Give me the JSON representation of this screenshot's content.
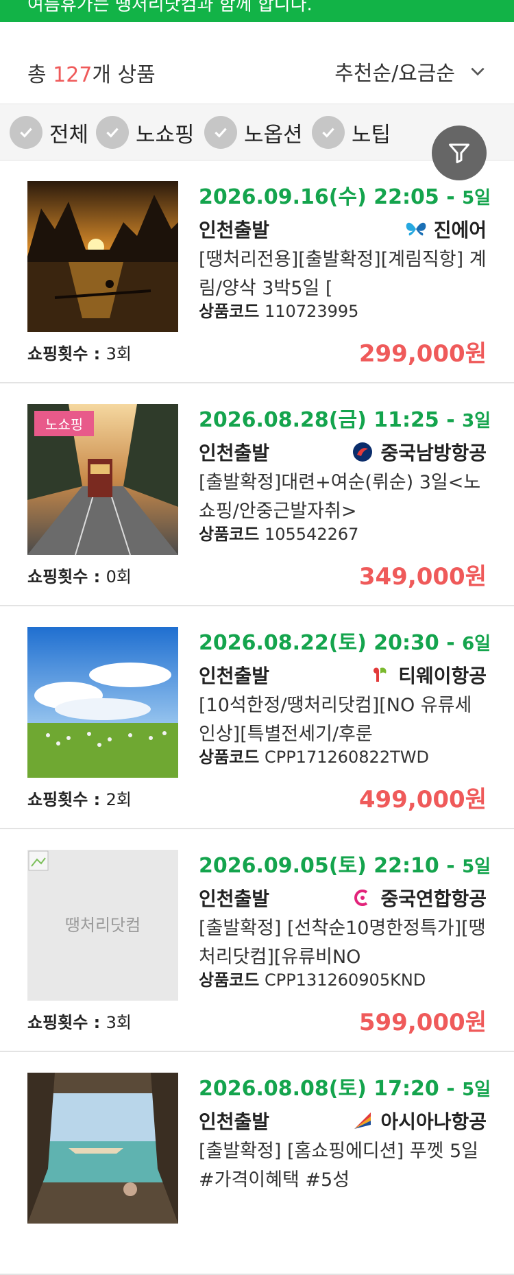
{
  "top_banner": {
    "text": "여름휴가는 땡처리닷컴과 함께 합니다."
  },
  "summary": {
    "prefix": "총 ",
    "count": "127",
    "suffix": "개 상품",
    "sort_label": "추천순/요금순"
  },
  "filters": [
    {
      "label": "전체"
    },
    {
      "label": "노쇼핑"
    },
    {
      "label": "노옵션"
    },
    {
      "label": "노팁"
    }
  ],
  "colors": {
    "accent_green": "#12b347",
    "date_green": "#14a44d",
    "price_red": "#ef5a5a",
    "badge_pink": "#e85a8a",
    "fab_gray": "#666666"
  },
  "products": [
    {
      "date": "2026.09.16(수) 22:05 - ",
      "duration": "5일",
      "departure": "인천출발",
      "airline": "진에어",
      "airline_icon": "butterfly-logo-icon",
      "title": "[땡처리전용][출발확정][계림직항] 계림/양삭 3박5일 [",
      "code_label": "상품코드",
      "code": "110723995",
      "shopping_label": "쇼핑횟수 : ",
      "shopping": "3회",
      "price": "299,000원",
      "badge": ""
    },
    {
      "date": "2026.08.28(금) 11:25 - ",
      "duration": "3일",
      "departure": "인천출발",
      "airline": "중국남방항공",
      "airline_icon": "china-southern-logo-icon",
      "title": "[출발확정]대련+여순(뤼순) 3일<노쇼핑/안중근발자취>",
      "code_label": "상품코드",
      "code": "105542267",
      "shopping_label": "쇼핑횟수 : ",
      "shopping": "0회",
      "price": "349,000원",
      "badge": "노쇼핑"
    },
    {
      "date": "2026.08.22(토) 20:30 - ",
      "duration": "6일",
      "departure": "인천출발",
      "airline": "티웨이항공",
      "airline_icon": "tway-logo-icon",
      "title": "[10석한정/땡처리닷컴][NO 유류세인상][특별전세기/후룬",
      "code_label": "상품코드",
      "code": "CPP171260822TWD",
      "shopping_label": "쇼핑횟수 : ",
      "shopping": "2회",
      "price": "499,000원",
      "badge": ""
    },
    {
      "date": "2026.09.05(토) 22:10 - ",
      "duration": "5일",
      "departure": "인천출발",
      "airline": "중국연합항공",
      "airline_icon": "china-united-logo-icon",
      "title": "[출발확정] [선착순10명한정특가][땡처리닷컴][유류비NO",
      "code_label": "상품코드",
      "code": "CPP131260905KND",
      "shopping_label": "쇼핑횟수 : ",
      "shopping": "3회",
      "price": "599,000원",
      "badge": "",
      "placeholder_text": "땡처리닷컴"
    },
    {
      "date": "2026.08.08(토) 17:20 - ",
      "duration": "5일",
      "departure": "인천출발",
      "airline": "아시아나항공",
      "airline_icon": "asiana-logo-icon",
      "title": "[출발확정] [홈쇼핑에디션] 푸껫 5일 #가격이혜택 #5성",
      "code_label": "",
      "code": "",
      "shopping_label": "",
      "shopping": "",
      "price": "",
      "badge": ""
    }
  ]
}
